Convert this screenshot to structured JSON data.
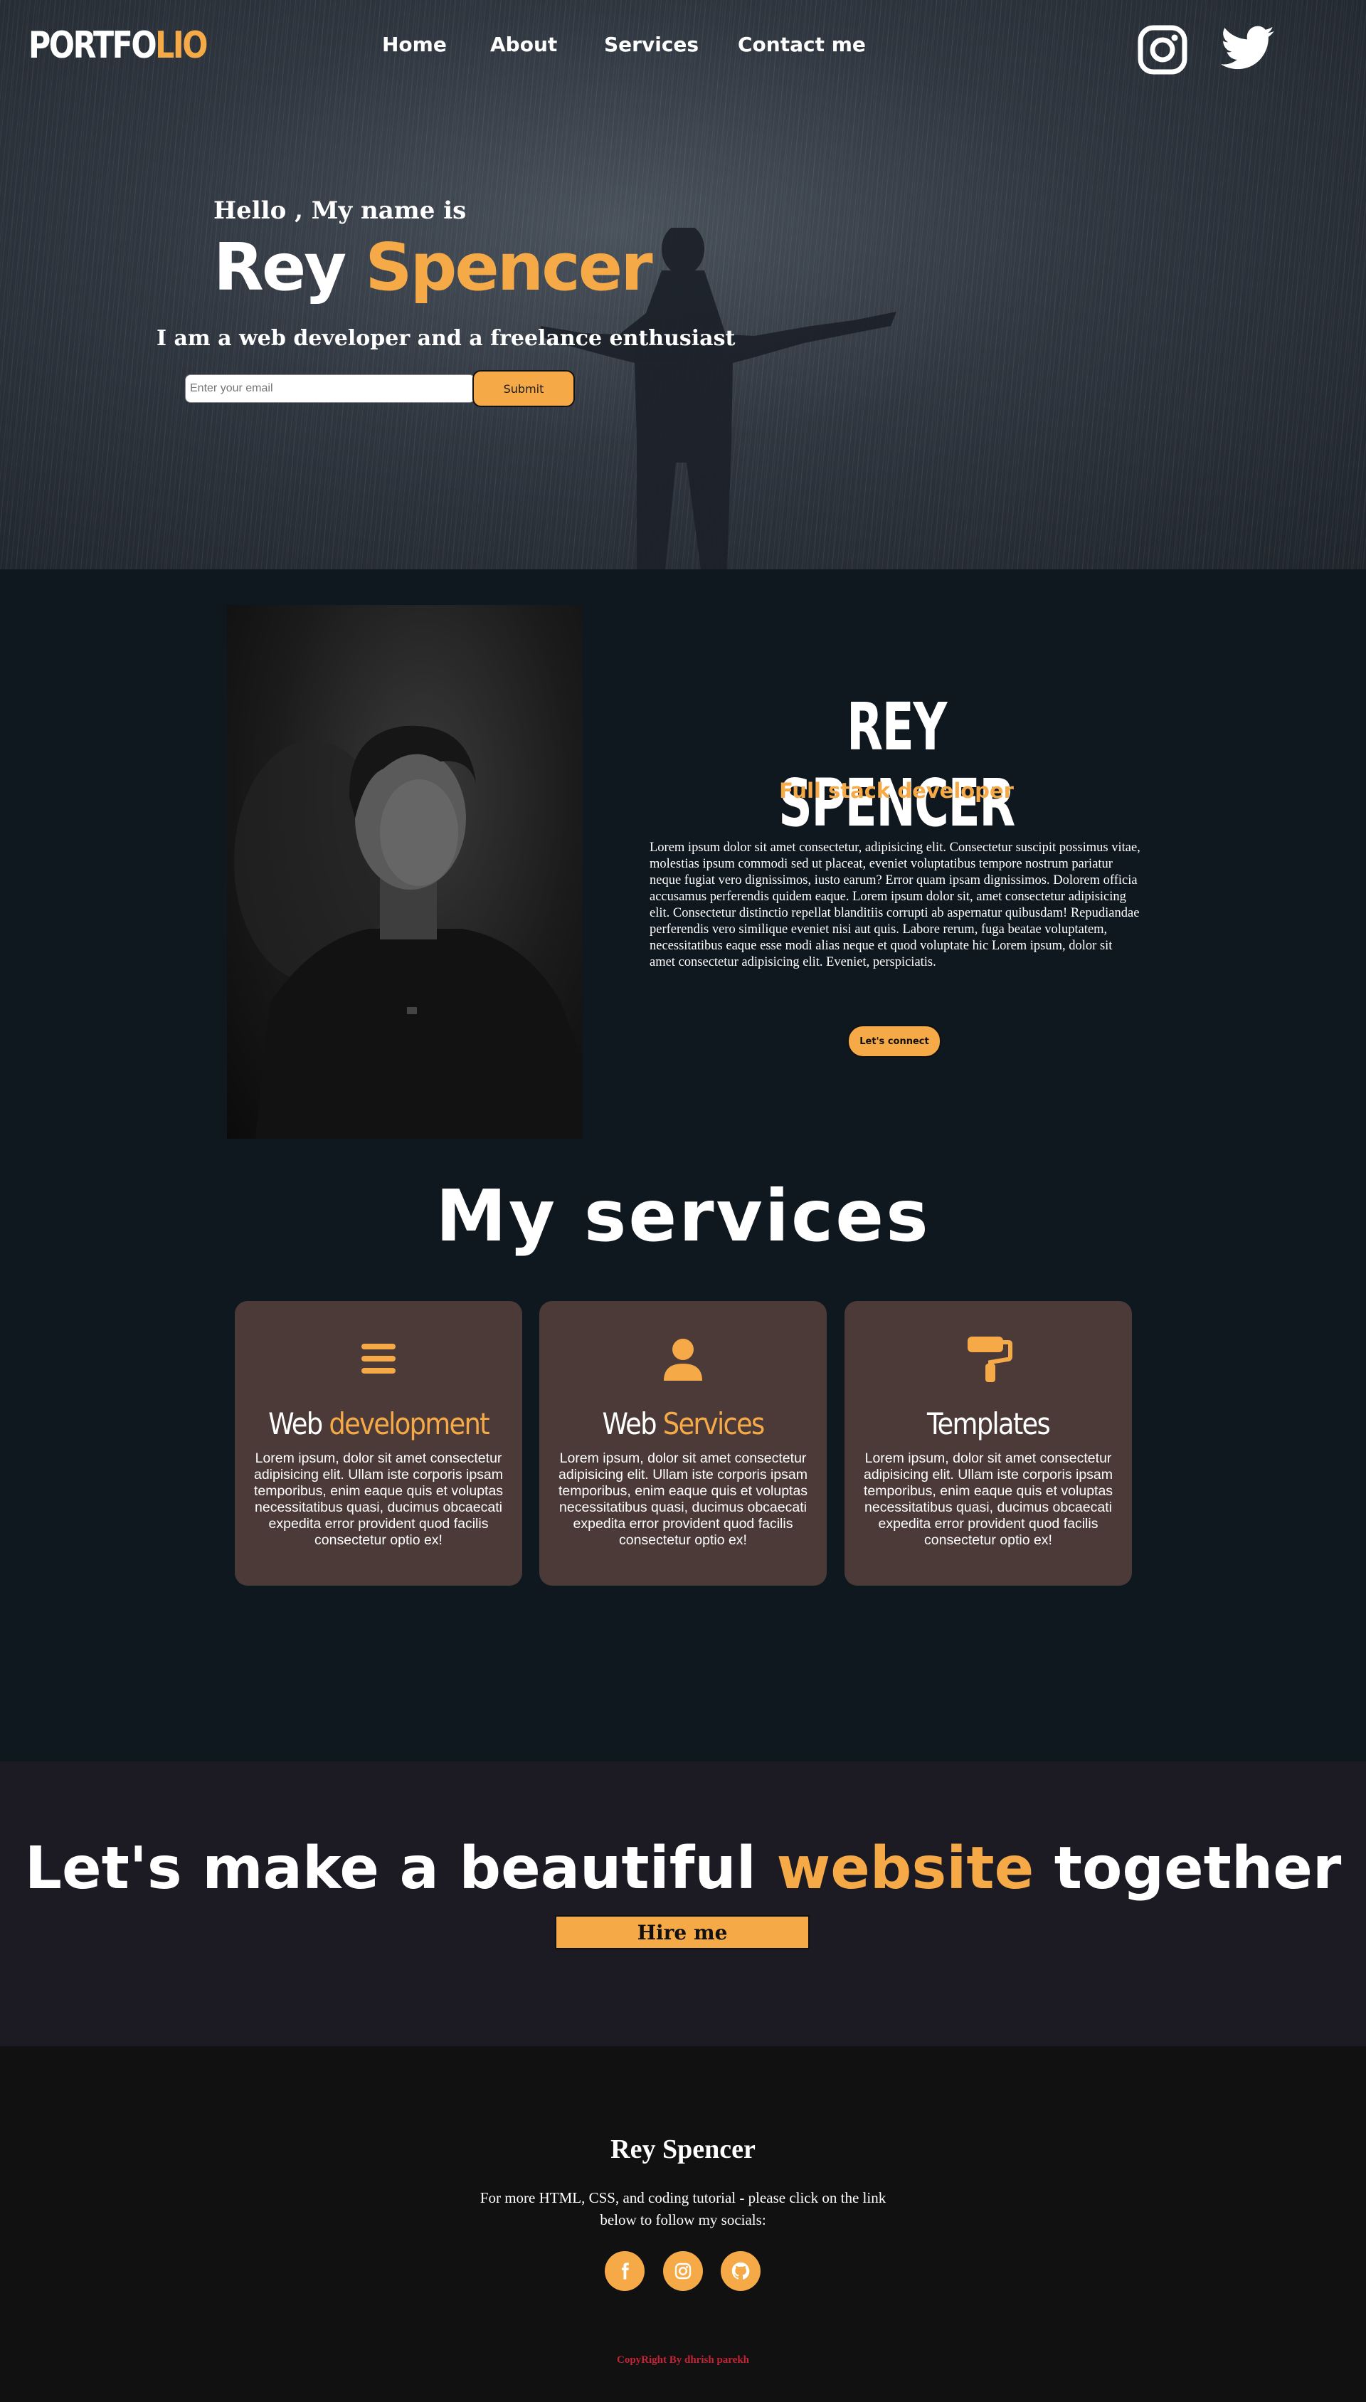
{
  "header": {
    "logo_part1": "PORTFO",
    "logo_part2": "LIO",
    "nav": [
      "Home",
      "About",
      "Services",
      "Contact me"
    ],
    "icons": [
      "instagram-icon",
      "twitter-icon"
    ]
  },
  "hero": {
    "greeting": "Hello , My name is",
    "first_name": "Rey",
    "last_name": "Spencer",
    "tagline": "I am a web developer and a freelance enthusiast",
    "email_placeholder": "Enter your email",
    "submit_label": "Submit"
  },
  "about": {
    "name": "REY SPENCER",
    "role": "Full stack developer",
    "description": "Lorem ipsum dolor sit amet consectetur, adipisicing elit. Consectetur suscipit possimus vitae, molestias ipsum commodi sed ut placeat, eveniet voluptatibus tempore nostrum pariatur neque fugiat vero dignissimos, iusto earum? Error quam ipsam dignissimos. Dolorem officia accusamus perferendis quidem eaque. Lorem ipsum dolor sit, amet consectetur adipisicing elit. Consectetur distinctio repellat blanditiis corrupti ab aspernatur quibusdam! Repudiandae perferendis vero similique eveniet nisi aut quis. Labore rerum, fuga beatae voluptatem, necessitatibus eaque esse modi alias neque et quod voluptate hic Lorem ipsum, dolor sit amet consectetur adipisicing elit. Eveniet, perspiciatis.",
    "connect_label": "Let's connect"
  },
  "services": {
    "title": "My services",
    "cards": [
      {
        "title_white": "Web ",
        "title_orange": "development",
        "icon": "bars-icon",
        "text": "Lorem ipsum, dolor sit amet consectetur adipisicing elit. Ullam iste corporis ipsam temporibus, enim eaque quis et voluptas necessitatibus quasi, ducimus obcaecati expedita error provident quod facilis consectetur optio ex!"
      },
      {
        "title_white": "Web ",
        "title_orange": "Services",
        "icon": "user-icon",
        "text": "Lorem ipsum, dolor sit amet consectetur adipisicing elit. Ullam iste corporis ipsam temporibus, enim eaque quis et voluptas necessitatibus quasi, ducimus obcaecati expedita error provident quod facilis consectetur optio ex!"
      },
      {
        "title_white": "Templates",
        "title_orange": "",
        "icon": "paint-roller-icon",
        "text": "Lorem ipsum, dolor sit amet consectetur adipisicing elit. Ullam iste corporis ipsam temporibus, enim eaque quis et voluptas necessitatibus quasi, ducimus obcaecati expedita error provident quod facilis consectetur optio ex!"
      }
    ]
  },
  "cta": {
    "title_part1": "Let's make a beautiful ",
    "title_highlight": "website",
    "title_part2": " together",
    "hire_label": "Hire me"
  },
  "footer": {
    "name": "Rey Spencer",
    "text": "For more HTML, CSS, and coding tutorial - please click on the link below to follow my socials:",
    "socials": [
      "facebook-icon",
      "instagram-icon",
      "github-icon"
    ],
    "copyright": "CopyRight By dhrish parekh"
  },
  "colors": {
    "accent": "#f5a947",
    "page_bg": "#0f171f",
    "card_bg": "#4b3a38",
    "cta_bg": "#1c1a23",
    "footer_bg": "#111111",
    "copyright": "#c52437"
  }
}
